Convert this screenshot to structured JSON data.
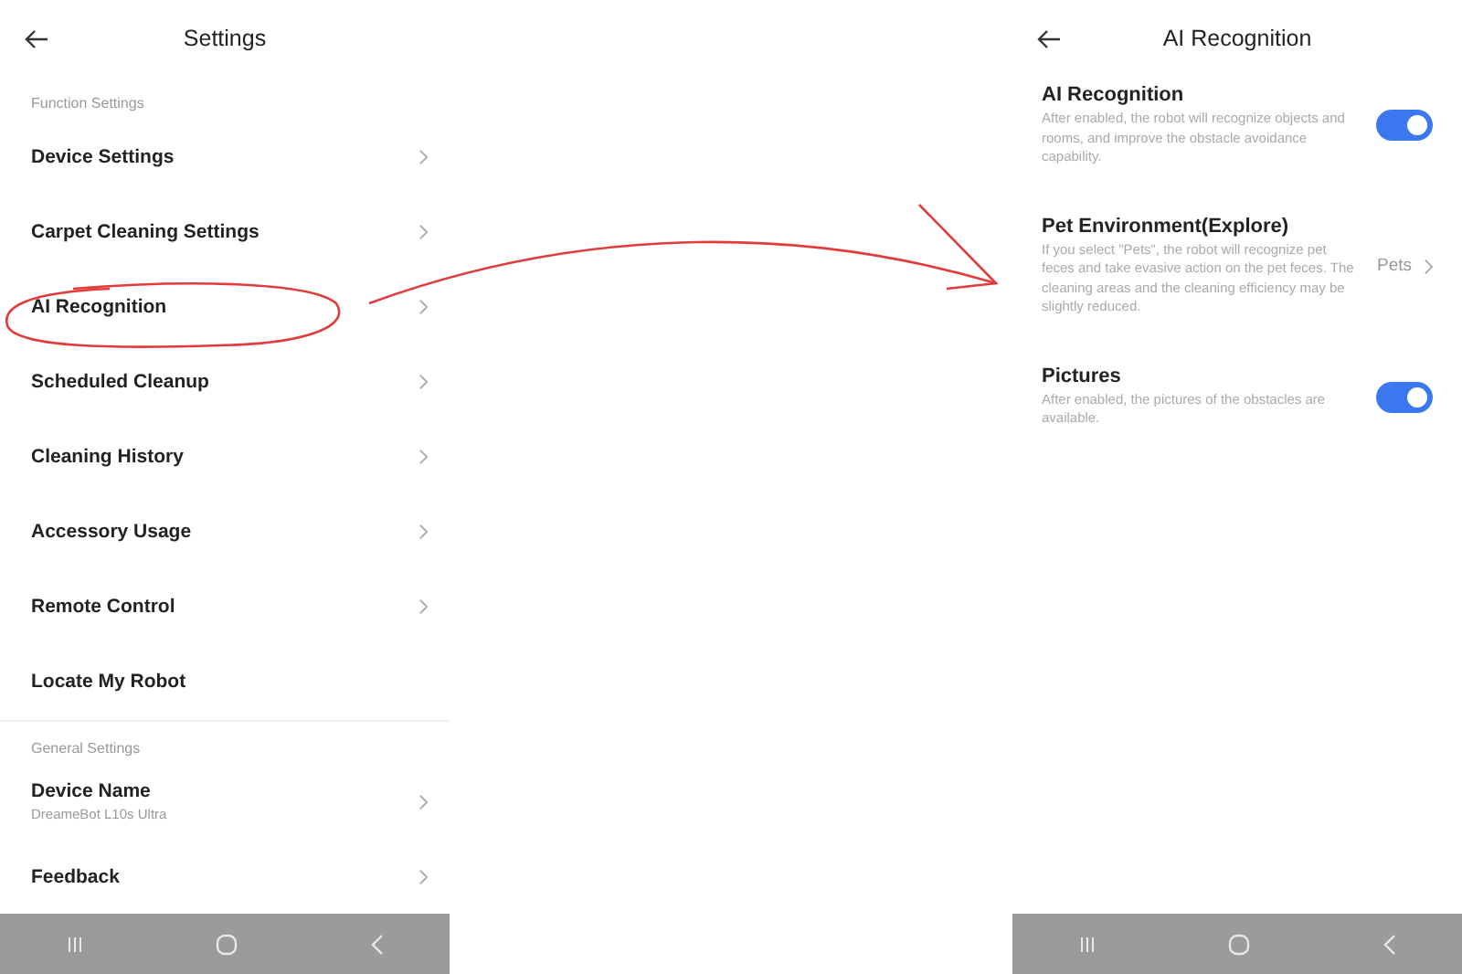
{
  "left_screen": {
    "title": "Settings",
    "sections": [
      {
        "heading": "Function Settings",
        "items": [
          {
            "label": "Device Settings",
            "chevron": true
          },
          {
            "label": "Carpet Cleaning Settings",
            "chevron": true
          },
          {
            "label": "AI Recognition",
            "chevron": true
          },
          {
            "label": "Scheduled Cleanup",
            "chevron": true
          },
          {
            "label": "Cleaning History",
            "chevron": true
          },
          {
            "label": "Accessory Usage",
            "chevron": true
          },
          {
            "label": "Remote Control",
            "chevron": true
          },
          {
            "label": "Locate My Robot",
            "chevron": false
          }
        ]
      },
      {
        "heading": "General Settings",
        "items": [
          {
            "label": "Device Name",
            "subtitle": "DreameBot L10s Ultra",
            "chevron": true
          },
          {
            "label": "Feedback",
            "chevron": true
          }
        ]
      }
    ]
  },
  "right_screen": {
    "title": "AI Recognition",
    "settings": [
      {
        "kind": "toggle",
        "title": "AI Recognition",
        "description": "After enabled, the robot will recognize objects and rooms, and improve the obstacle avoidance capability.",
        "on": true
      },
      {
        "kind": "select",
        "title": "Pet Environment(Explore)",
        "description": "If you select \"Pets\", the robot will recognize pet feces and take evasive action on the pet feces. The cleaning areas and the cleaning efficiency may be slightly reduced.",
        "value": "Pets"
      },
      {
        "kind": "toggle",
        "title": "Pictures",
        "description": "After enabled, the pictures of the obstacles are available.",
        "on": true
      }
    ]
  }
}
